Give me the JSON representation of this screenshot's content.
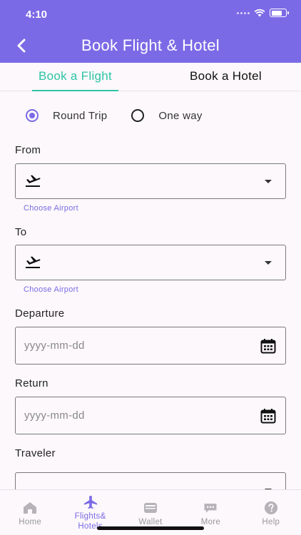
{
  "status_bar": {
    "time": "4:10",
    "battery_level": 0.75
  },
  "header": {
    "title": "Book Flight & Hotel",
    "back_icon": "chevron-left-icon"
  },
  "tabs": [
    {
      "label": "Book a Flight",
      "active": true
    },
    {
      "label": "Book a Hotel",
      "active": false
    }
  ],
  "trip_type": {
    "options": [
      {
        "label": "Round Trip",
        "selected": true
      },
      {
        "label": "One way",
        "selected": false
      }
    ]
  },
  "from": {
    "label": "From",
    "value": "",
    "helper": "Choose Airport",
    "icon": "plane-takeoff-icon"
  },
  "to": {
    "label": "To",
    "value": "",
    "helper": "Choose Airport",
    "icon": "plane-takeoff-icon"
  },
  "departure": {
    "label": "Departure",
    "placeholder": "yyyy-mm-dd",
    "icon": "calendar-icon"
  },
  "return": {
    "label": "Return",
    "placeholder": "yyyy-mm-dd",
    "icon": "calendar-icon"
  },
  "traveler": {
    "label": "Traveler",
    "value": ""
  },
  "bottom_nav": [
    {
      "label": "Home",
      "icon": "home-icon",
      "active": false
    },
    {
      "label": "Flights& Hotels",
      "icon": "airplane-icon",
      "active": true
    },
    {
      "label": "Wallet",
      "icon": "wallet-icon",
      "active": false
    },
    {
      "label": "More",
      "icon": "more-icon",
      "active": false
    },
    {
      "label": "Help",
      "icon": "help-icon",
      "active": false
    }
  ],
  "colors": {
    "primary": "#7b6ae6",
    "accent": "#2ec4a5",
    "background": "#fcf8fb"
  }
}
